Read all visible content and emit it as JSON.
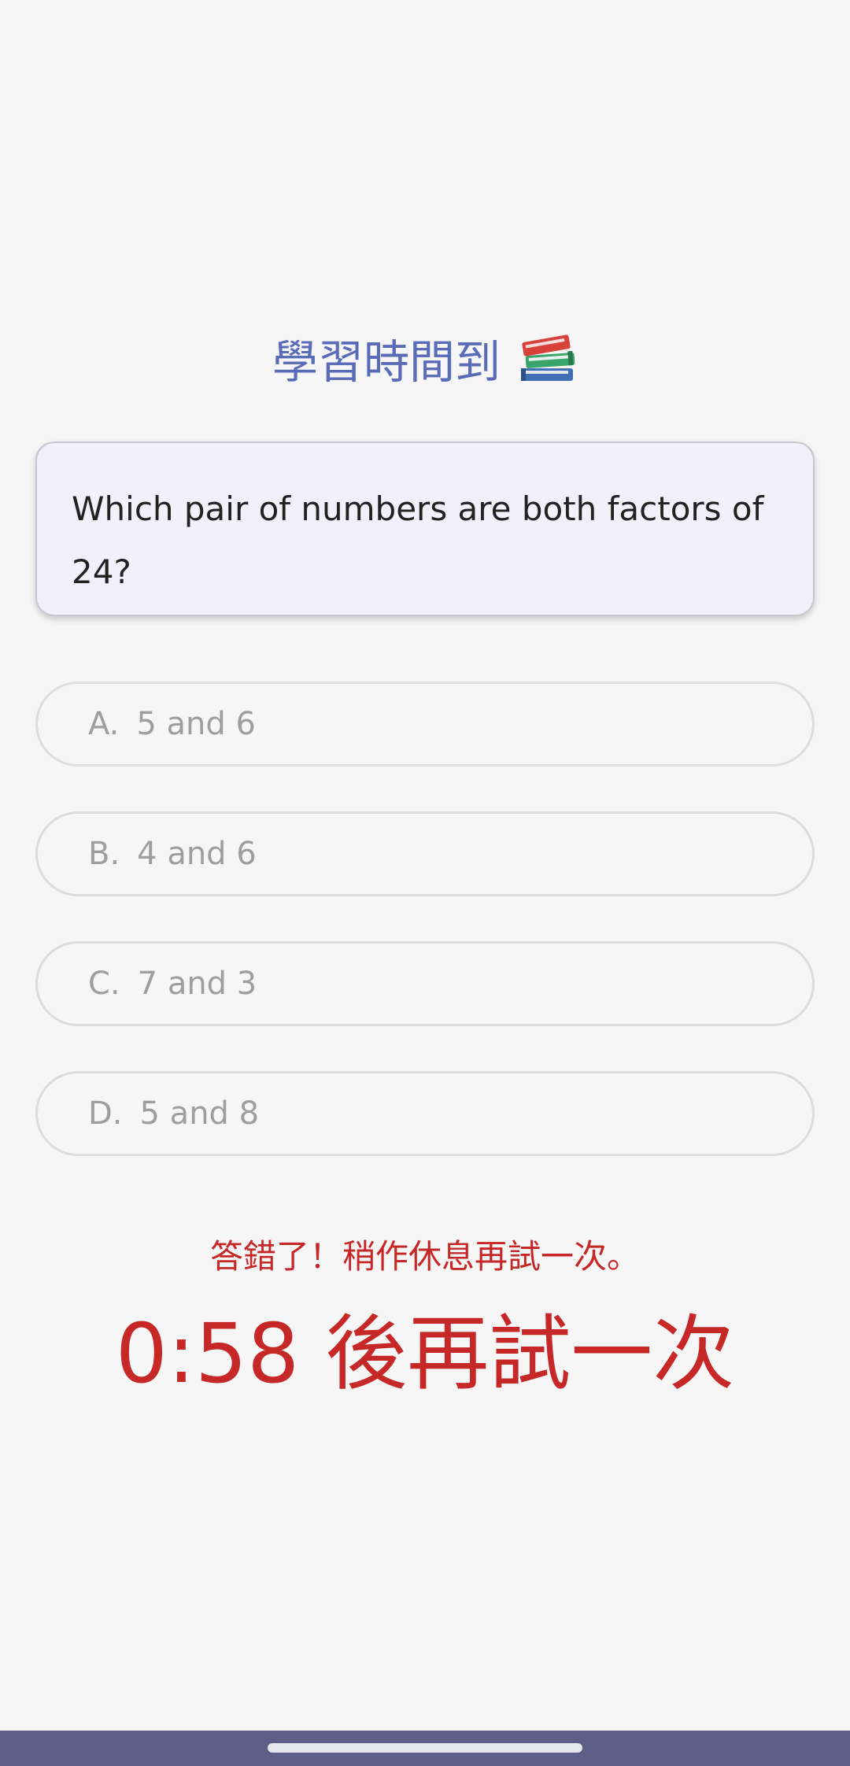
{
  "header": {
    "title": "學習時間到",
    "title_icon": "books-icon"
  },
  "question": {
    "text": "Which pair of numbers are both factors of 24?"
  },
  "options": [
    {
      "letter": "A.",
      "text": "5 and 6"
    },
    {
      "letter": "B.",
      "text": "4 and 6"
    },
    {
      "letter": "C.",
      "text": "7 and 3"
    },
    {
      "letter": "D.",
      "text": "5 and 8"
    }
  ],
  "feedback": {
    "message": "答錯了！稍作休息再試一次。",
    "countdown": "0:58 後再試一次"
  },
  "colors": {
    "title": "#5a6bb8",
    "error": "#c62828",
    "card_bg": "#f2f0fa",
    "nav_bar": "#5e5f86"
  }
}
